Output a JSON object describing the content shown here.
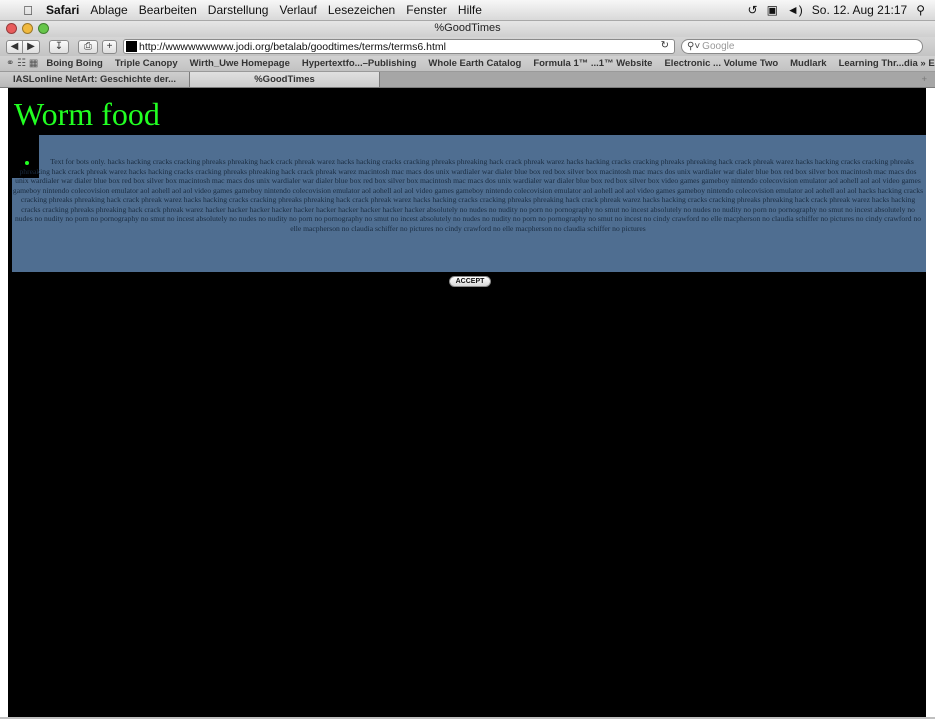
{
  "menubar": {
    "app": "Safari",
    "items": [
      "Ablage",
      "Bearbeiten",
      "Darstellung",
      "Verlauf",
      "Lesezeichen",
      "Fenster",
      "Hilfe"
    ],
    "datetime": "So. 12. Aug 21:17"
  },
  "window": {
    "title": "%GoodTimes"
  },
  "toolbar": {
    "url": "http://wwwwwwwww.jodi.org/betalab/goodtimes/terms/terms6.html",
    "search_placeholder": "Google"
  },
  "bookmarks": [
    "Boing Boing",
    "Triple Canopy",
    "Wirth_Uwe Homepage",
    "Hypertextfo...–Publishing",
    "Whole Earth Catalog",
    "Formula 1™ ...1™ Website",
    "Electronic ... Volume Two",
    "Mudlark",
    "Learning Thr...dia » Essay"
  ],
  "tabs": [
    {
      "label": "IASLonline NetArt: Geschichte der...",
      "active": false
    },
    {
      "label": "%GoodTimes",
      "active": true
    }
  ],
  "page": {
    "heading": "Worm food",
    "bots_text": "Text for bots only. hacks hacking cracks cracking phreaks phreaking hack crack phreak warez hacks hacking cracks cracking phreaks phreaking hack crack phreak warez hacks hacking cracks cracking phreaks phreaking hack crack phreak warez hacks hacking cracks cracking phreaks phreaking hack crack phreak warez hacks hacking cracks cracking phreaks phreaking hack crack phreak warez macintosh mac macs dos unix wardialer war dialer blue box red box silver box macintosh mac macs dos unix wardialer war dialer blue box red box silver box macintosh mac macs dos unix wardialer war dialer blue box red box silver box macintosh mac macs dos unix wardialer war dialer blue box red box silver box macintosh mac macs dos unix wardialer war dialer blue box red box silver box video games gameboy nintendo colecovision emulator aol aohell aol aol video games gameboy nintendo colecovision emulator aol aohell aol aol video games gameboy nintendo colecovision emulator aol aohell aol aol video games gameboy nintendo colecovision emulator aol aohell aol aol video games gameboy nintendo colecovision emulator aol aohell aol aol hacks hacking cracks cracking phreaks phreaking hack crack phreak warez hacks hacking cracks cracking phreaks phreaking hack crack phreak warez hacks hacking cracks cracking phreaks phreaking hack crack phreak warez hacks hacking cracks cracking phreaks phreaking hack crack phreak warez hacks hacking cracks cracking phreaks phreaking hack crack phreak warez hacker hacker hacker hacker hacker hacker hacker hacker hacker hacker absolutely no nudes no nudity no porn no pornography no smut no incest absolutely no nudes no nudity no porn no pornography no smut no incest absolutely no nudes no nudity no porn no pornography no smut no incest absolutely no nudes no nudity no porn no pornography no smut no incest absolutely no nudes no nudity no porn no pornography no smut no incest no cindy crawford no elle macpherson no claudia schiffer no pictures no cindy crawford no elle macpherson no claudia schiffer no pictures no cindy crawford no elle macpherson no claudia schiffer no pictures",
    "accept_label": "ACCEPT"
  },
  "colors": {
    "heading": "#22ff22",
    "background": "#000000",
    "selection": "#4f6e91"
  }
}
